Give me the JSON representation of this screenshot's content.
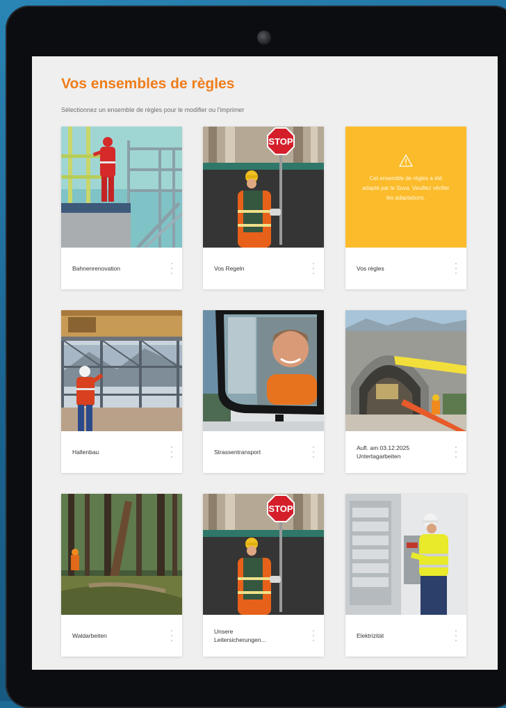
{
  "header": {
    "title": "Vos ensembles de règles",
    "subtitle": "Sélectionnez un ensemble de règles pour le modifier ou l'imprimer"
  },
  "cards": [
    {
      "label": "Bahnenrenovation",
      "image": "worker-on-scaffold-photo"
    },
    {
      "label": "Vos Regeln",
      "image": "stop-sign-worker-photo"
    },
    {
      "label": "Vos règles",
      "notice": "Cet ensemble de règles a été adapté par le Suva. Veuillez vérifier les adaptations.",
      "image": "warning-icon"
    },
    {
      "label": "Hallenbau",
      "image": "hall-construction-worker-photo"
    },
    {
      "label": "Strassentransport",
      "image": "truck-driver-mirror-photo"
    },
    {
      "label": "Aufl. am 03.12.2025 Untertagarbeiten",
      "line1": "Aufl. am 03.12.2025",
      "line2": "Untertagarbeiten",
      "image": "tunnel-construction-photo"
    },
    {
      "label": "Waldarbeiten",
      "image": "forest-work-photo"
    },
    {
      "label": "Unsere Leitersicherungen...",
      "line1": "Unsere",
      "line2": "Leitersicherungen...",
      "image": "stop-sign-worker-photo"
    },
    {
      "label": "Elektrizität",
      "image": "electrician-photo"
    }
  ],
  "colors": {
    "accent": "#ef7d1a",
    "notice_bg": "#fbbb2a",
    "screen_bg": "#efefef",
    "background": "#1d6a94"
  },
  "icons": {
    "card_menu": "more-vertical-icon",
    "notice": "warning-icon"
  }
}
